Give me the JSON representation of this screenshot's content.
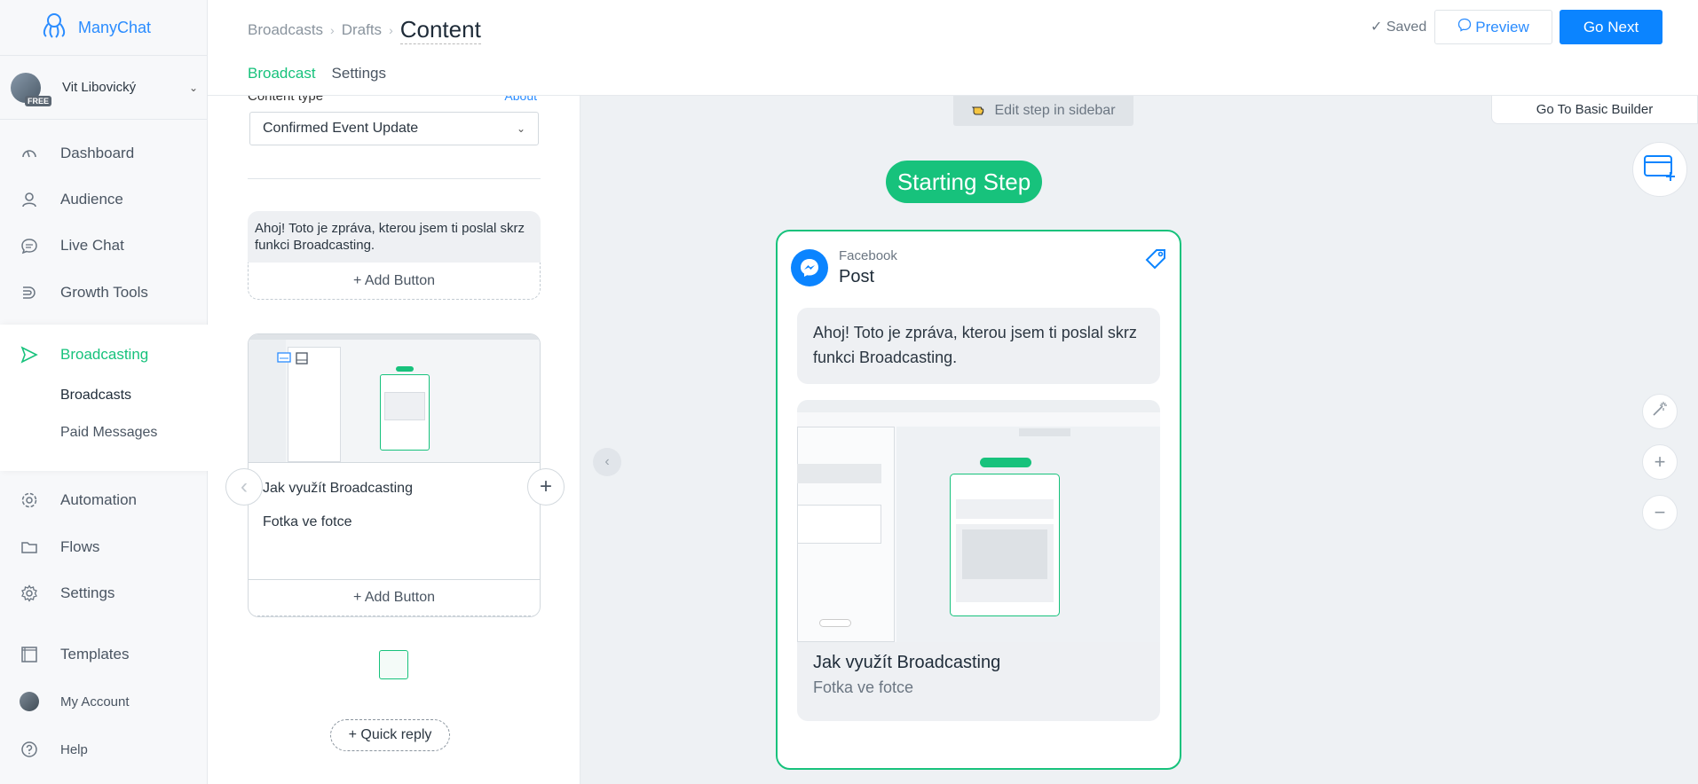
{
  "brand": {
    "name": "ManyChat"
  },
  "user": {
    "name": "Vit Libovický",
    "badge": "FREE"
  },
  "nav": {
    "items": [
      {
        "label": "Dashboard",
        "icon": "dashboard-icon"
      },
      {
        "label": "Audience",
        "icon": "person-icon"
      },
      {
        "label": "Live Chat",
        "icon": "chat-icon"
      },
      {
        "label": "Growth Tools",
        "icon": "growth-icon"
      },
      {
        "label": "Broadcasting",
        "icon": "send-icon"
      },
      {
        "label": "Automation",
        "icon": "automation-icon"
      },
      {
        "label": "Flows",
        "icon": "folder-icon"
      },
      {
        "label": "Settings",
        "icon": "gear-icon"
      },
      {
        "label": "Templates",
        "icon": "templates-icon"
      },
      {
        "label": "My Account",
        "icon": "account-avatar-icon"
      },
      {
        "label": "Help",
        "icon": "help-icon"
      }
    ],
    "sub_items": [
      "Broadcasts",
      "Paid Messages"
    ]
  },
  "header": {
    "breadcrumbs": [
      "Broadcasts",
      "Drafts"
    ],
    "current": "Content",
    "tabs": [
      "Broadcast",
      "Settings"
    ],
    "saved": "Saved",
    "preview": "Preview",
    "go_next": "Go Next"
  },
  "editor": {
    "content_type_label": "Content type",
    "content_type_link": "About",
    "content_type_value": "Confirmed Event Update",
    "message_text": "Ahoj! Toto je zpráva, kterou jsem ti poslal skrz funkci Broadcasting.",
    "add_button": "+ Add Button",
    "gallery_title": "Jak využít Broadcasting",
    "gallery_subtitle": "Fotka ve fotce",
    "quick_reply": "+ Quick reply"
  },
  "canvas": {
    "edit_hint": "Edit step in sidebar",
    "basic_builder": "Go To Basic Builder",
    "starting_step": "Starting Step",
    "node": {
      "platform": "Facebook",
      "type": "Post",
      "message": "Ahoj! Toto je zpráva, kterou jsem ti poslal skrz funkci Broadcasting.",
      "card_title": "Jak využít Broadcasting",
      "card_subtitle": "Fotka ve fotce"
    }
  },
  "colors": {
    "accent_green": "#17c27c",
    "accent_blue": "#0b84ff"
  }
}
